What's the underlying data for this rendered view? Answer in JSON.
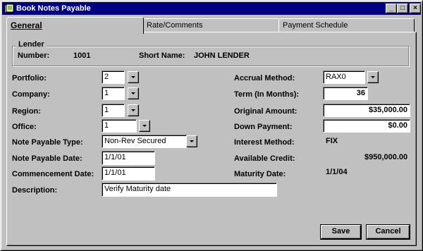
{
  "window": {
    "title": "Book Notes Payable",
    "buttons": {
      "minimize": "_",
      "maximize": "□",
      "close": "×"
    }
  },
  "tabs": [
    {
      "label": "General",
      "active": true
    },
    {
      "label": "Rate/Comments",
      "active": false
    },
    {
      "label": "Payment Schedule",
      "active": false
    }
  ],
  "lender": {
    "group_label": "Lender",
    "number_label": "Number:",
    "number_value": "1001",
    "short_name_label": "Short Name:",
    "short_name_value": "JOHN LENDER"
  },
  "left_fields": {
    "portfolio": {
      "label": "Portfolio:",
      "value": "2"
    },
    "company": {
      "label": "Company:",
      "value": "1"
    },
    "region": {
      "label": "Region:",
      "value": "1"
    },
    "office": {
      "label": "Office:",
      "value": "1"
    },
    "note_payable_type": {
      "label": "Note Payable Type:",
      "value": "Non-Rev Secured"
    },
    "note_payable_date": {
      "label": "Note Payable Date:",
      "value": "1/1/01"
    },
    "commencement_date": {
      "label": "Commencement Date:",
      "value": "1/1/01"
    },
    "description": {
      "label": "Description:",
      "value": "Verify Maturity date"
    }
  },
  "right_fields": {
    "accrual_method": {
      "label": "Accrual Method:",
      "value": "RAX0"
    },
    "term": {
      "label": "Term (In Months):",
      "value": "36"
    },
    "original_amount": {
      "label": "Original Amount:",
      "value": "$35,000.00"
    },
    "down_payment": {
      "label": "Down Payment:",
      "value": "$0.00"
    },
    "interest_method": {
      "label": "Interest Method:",
      "value": "FIX"
    },
    "available_credit": {
      "label": "Available Credit:",
      "value": "$950,000.00"
    },
    "maturity_date": {
      "label": "Maturity Date:",
      "value": "1/1/04"
    }
  },
  "actions": {
    "save": "Save",
    "cancel": "Cancel"
  },
  "colors": {
    "titlebar": "#000080",
    "face": "#c0c0c0",
    "field": "#ffffff"
  }
}
